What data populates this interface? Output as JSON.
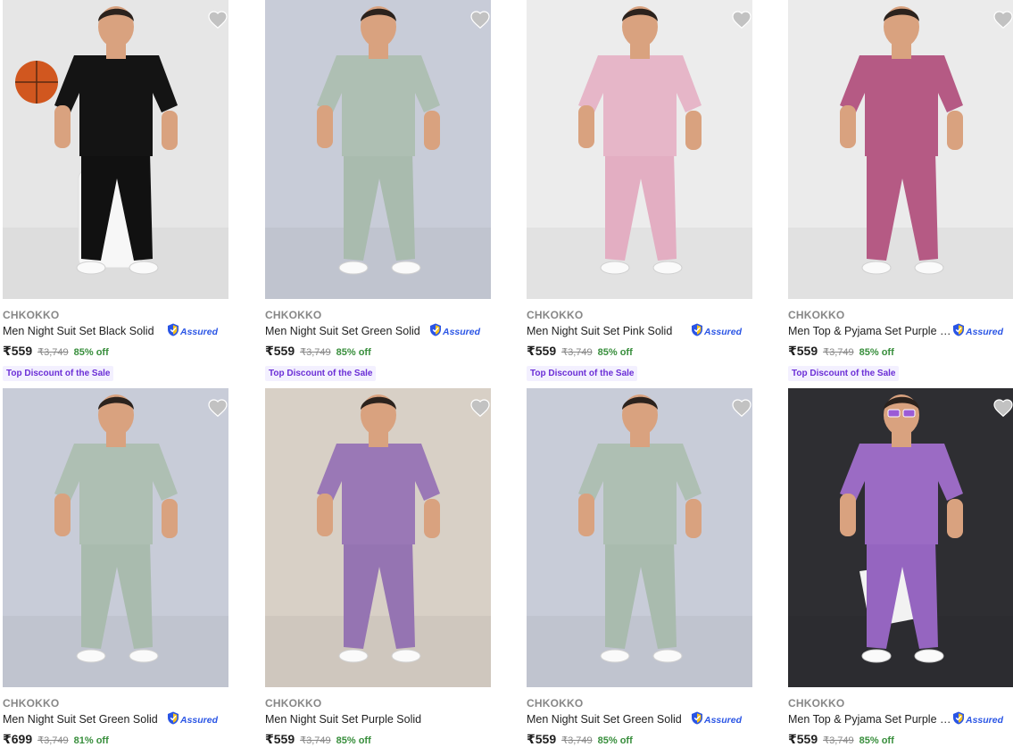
{
  "colors": {
    "brand_text": "#878787",
    "price_text": "#212121",
    "discount_green": "#388e3c",
    "assured_blue": "#2a55e5",
    "badge_bg": "#f3f0ff",
    "badge_text": "#6b2fd6",
    "wishlist_heart": "#c2c2c2"
  },
  "products": [
    {
      "brand": "CHKOKKO",
      "title": "Men Night Suit Set Black Solid",
      "price": "₹559",
      "mrp": "₹3,749",
      "discount": "85% off",
      "assured": "Assured",
      "badge": "Top Discount of the Sale",
      "image": {
        "bg": "#e6e6e6",
        "shirt": "#141414",
        "pants": "#111111",
        "prop": "ball-and-stool"
      }
    },
    {
      "brand": "CHKOKKO",
      "title": "Men Night Suit Set Green Solid",
      "price": "₹559",
      "mrp": "₹3,749",
      "discount": "85% off",
      "assured": "Assured",
      "badge": "Top Discount of the Sale",
      "image": {
        "bg": "#c8ccd8",
        "shirt": "#aebfb3",
        "pants": "#a9bbae"
      }
    },
    {
      "brand": "CHKOKKO",
      "title": "Men Night Suit Set Pink Solid",
      "price": "₹559",
      "mrp": "₹3,749",
      "discount": "85% off",
      "assured": "Assured",
      "badge": "Top Discount of the Sale",
      "image": {
        "bg": "#ececec",
        "shirt": "#e6b6c8",
        "pants": "#e3aec2"
      }
    },
    {
      "brand": "CHKOKKO",
      "title": "Men Top & Pyjama Set Purple So...",
      "price": "₹559",
      "mrp": "₹3,749",
      "discount": "85% off",
      "assured": "Assured",
      "badge": "Top Discount of the Sale",
      "image": {
        "bg": "#ebebeb",
        "shirt": "#b55a84",
        "pants": "#b55a84"
      }
    },
    {
      "brand": "CHKOKKO",
      "title": "Men Night Suit Set Green Solid",
      "price": "₹699",
      "mrp": "₹3,749",
      "discount": "81% off",
      "assured": "Assured",
      "badge": "",
      "image": {
        "bg": "#c8ccd8",
        "shirt": "#aebfb3",
        "pants": "#a9bbae"
      }
    },
    {
      "brand": "CHKOKKO",
      "title": "Men Night Suit Set Purple Solid",
      "price": "₹559",
      "mrp": "₹3,749",
      "discount": "85% off",
      "assured": "",
      "badge": "",
      "image": {
        "bg": "#d8d0c6",
        "shirt": "#9a78b6",
        "pants": "#9574b2"
      }
    },
    {
      "brand": "CHKOKKO",
      "title": "Men Night Suit Set Green Solid",
      "price": "₹559",
      "mrp": "₹3,749",
      "discount": "85% off",
      "assured": "Assured",
      "badge": "",
      "image": {
        "bg": "#c8ccd8",
        "shirt": "#aebfb3",
        "pants": "#a9bbae"
      }
    },
    {
      "brand": "CHKOKKO",
      "title": "Men Top & Pyjama Set Purple So...",
      "price": "₹559",
      "mrp": "₹3,749",
      "discount": "85% off",
      "assured": "Assured",
      "badge": "",
      "image": {
        "bg": "#2e2e32",
        "shirt": "#9b6bc4",
        "pants": "#9565c0",
        "prop": "stool-and-sunglasses"
      }
    }
  ]
}
